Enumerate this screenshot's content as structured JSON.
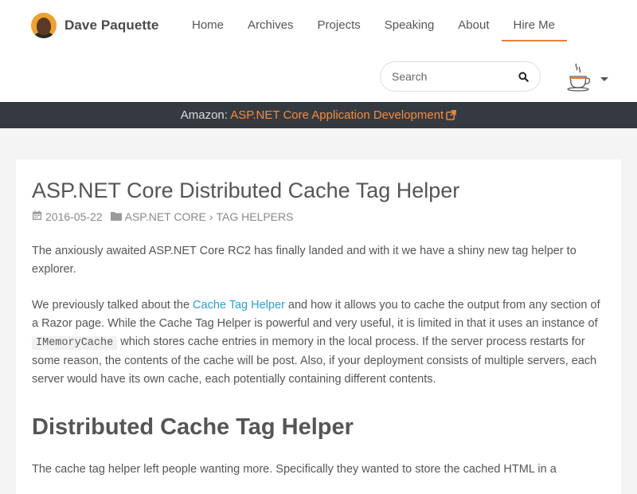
{
  "header": {
    "brand_name": "Dave Paquette",
    "nav": [
      {
        "label": "Home",
        "active": false
      },
      {
        "label": "Archives",
        "active": false
      },
      {
        "label": "Projects",
        "active": false
      },
      {
        "label": "Speaking",
        "active": false
      },
      {
        "label": "About",
        "active": false
      },
      {
        "label": "Hire Me",
        "active": true
      }
    ],
    "search": {
      "placeholder": "Search",
      "value": ""
    },
    "theme_icon": "coffee-cup-icon",
    "accent_color": "#e8803a"
  },
  "banner": {
    "prefix": "Amazon:",
    "link_text": "ASP.NET Core Application Development",
    "link_color": "#f58b42",
    "background": "#343a40"
  },
  "article": {
    "title": "ASP.NET Core Distributed Cache Tag Helper",
    "date": "2016-05-22",
    "category_1": "ASP.NET CORE",
    "category_sep": "›",
    "category_2": "TAG HELPERS",
    "p1": "The anxiously awaited ASP.NET Core RC2 has finally landed and with it we have a shiny new tag helper to explorer.",
    "p2": {
      "before_link": "We previously talked about the ",
      "link": "Cache Tag Helper",
      "after_link": " and how it allows you to cache the output from any section of a Razor page. While the Cache Tag Helper is powerful and very useful, it is limited in that it uses an instance of ",
      "code": "IMemoryCache",
      "after_code": " which stores cache entries in memory in the local process. If the server process restarts for some reason, the contents of the cache will be post. Also, if your deployment consists of multiple servers, each server would have its own cache, each potentially containing different contents."
    },
    "h2": "Distributed Cache Tag Helper",
    "p3": "The cache tag helper left people wanting more. Specifically they wanted to store the cached HTML in a"
  }
}
